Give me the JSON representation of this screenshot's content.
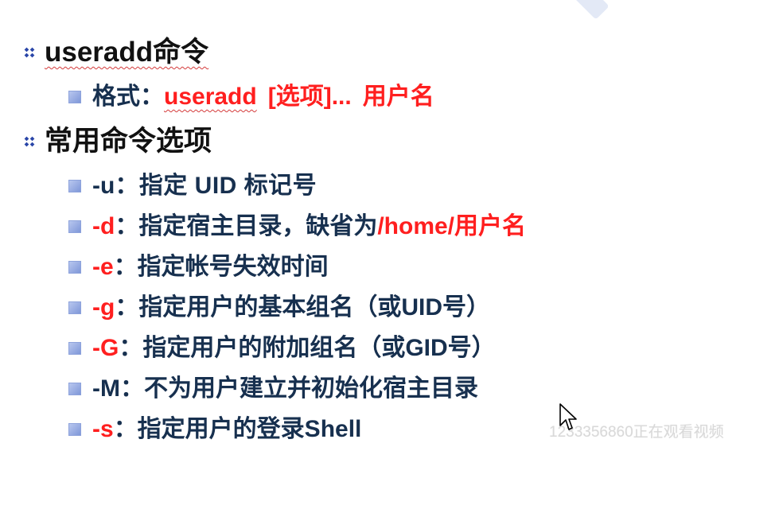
{
  "slide": {
    "heading_1": "useradd命令",
    "format_label": "格式：",
    "format_cmd": "useradd",
    "format_options": "[选项]...",
    "format_username": "用户名",
    "heading_2": "常用命令选项",
    "options": [
      {
        "flag": "-u",
        "description": "：指定 UID 标记号"
      },
      {
        "flag": "-d",
        "description": "：指定宿主目录，缺省为",
        "suffix": "/home/用户名"
      },
      {
        "flag": "-e",
        "description": "：指定帐号失效时间"
      },
      {
        "flag": "-g",
        "description": "：指定用户的基本组名（或UID号）"
      },
      {
        "flag": "-G",
        "description": "：指定用户的附加组名（或GID号）"
      },
      {
        "flag": "-M",
        "description": "：不为用户建立并初始化宿主目录"
      },
      {
        "flag": "-s",
        "description": "：指定用户的登录Shell"
      }
    ]
  },
  "overlay": {
    "watching_text": "1233356860正在观看视频"
  },
  "colors": {
    "red": "#ff1f1f",
    "dark_text": "#17304f",
    "bullet_blue": "#2a46a8"
  }
}
